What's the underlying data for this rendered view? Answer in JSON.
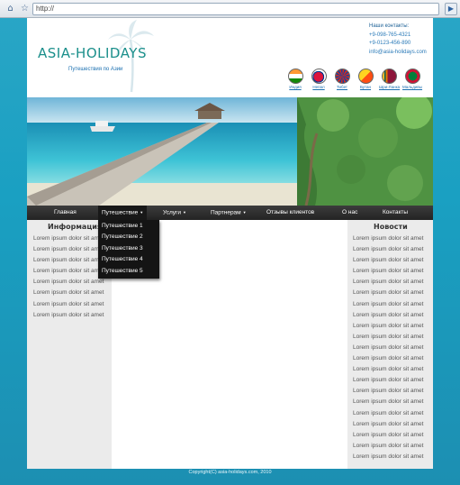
{
  "browser": {
    "home_icon": "home-icon",
    "star_icon": "star-icon",
    "url": "http://",
    "go_icon": "play-icon"
  },
  "header": {
    "logo": "ASIA-HOLIDAYS",
    "tagline": "Путешествия по Азии",
    "contacts": {
      "title": "Наши контакты:",
      "phone1": "+9-098-765-4321",
      "phone2": "+9-0123-456-890",
      "email": "info@asia-holidays.com"
    },
    "flags": [
      {
        "label": "Индия",
        "colors": [
          "#ff9933",
          "#ffffff",
          "#138808"
        ]
      },
      {
        "label": "Непал",
        "colors": [
          "#dc143c",
          "#ffffff",
          "#003893"
        ]
      },
      {
        "label": "Тибет",
        "colors": [
          "#d52b1e",
          "#ffd400",
          "#1e3f9a"
        ]
      },
      {
        "label": "Бутан",
        "colors": [
          "#ffd520",
          "#ff4e12",
          "#ffffff"
        ]
      },
      {
        "label": "Шри-Ланка",
        "colors": [
          "#8d153a",
          "#ffbe29",
          "#eb7400"
        ]
      },
      {
        "label": "Мальдивы",
        "colors": [
          "#d21034",
          "#007e3a",
          "#ffffff"
        ]
      }
    ]
  },
  "nav": {
    "items": [
      {
        "label": "Главная",
        "dropdown": false
      },
      {
        "label": "Путешествие",
        "dropdown": true
      },
      {
        "label": "Услуги",
        "dropdown": true
      },
      {
        "label": "Партнерам",
        "dropdown": true
      },
      {
        "label": "Отзывы клиентов",
        "dropdown": false
      },
      {
        "label": "О нас",
        "dropdown": false
      },
      {
        "label": "Контакты",
        "dropdown": false
      }
    ],
    "caret": "▼",
    "dropdown_items": [
      "Путешествие 1",
      "Путешествие 2",
      "Путешествие 3",
      "Путешествие 4",
      "Путешествие 5"
    ]
  },
  "left": {
    "title": "Информация",
    "items": [
      "Lorem ipsum dolor sit amet",
      "Lorem ipsum dolor sit amet",
      "Lorem ipsum dolor sit amet",
      "Lorem ipsum dolor sit amet",
      "Lorem ipsum dolor sit amet",
      "Lorem ipsum dolor sit amet",
      "Lorem ipsum dolor sit amet",
      "Lorem ipsum dolor sit amet"
    ]
  },
  "right": {
    "title": "Новости",
    "items": [
      "Lorem ipsum dolor sit amet",
      "Lorem ipsum dolor sit amet",
      "Lorem ipsum dolor sit amet",
      "Lorem ipsum dolor sit amet",
      "Lorem ipsum dolor sit amet",
      "Lorem ipsum dolor sit amet",
      "Lorem ipsum dolor sit amet",
      "Lorem ipsum dolor sit amet",
      "Lorem ipsum dolor sit amet",
      "Lorem ipsum dolor sit amet",
      "Lorem ipsum dolor sit amet",
      "Lorem ipsum dolor sit amet",
      "Lorem ipsum dolor sit amet",
      "Lorem ipsum dolor sit amet",
      "Lorem ipsum dolor sit amet",
      "Lorem ipsum dolor sit amet",
      "Lorem ipsum dolor sit amet",
      "Lorem ipsum dolor sit amet",
      "Lorem ipsum dolor sit amet",
      "Lorem ipsum dolor sit amet",
      "Lorem ipsum dolor sit amet"
    ]
  },
  "footer": "Copyright(C) asia-holidays.com, 2010"
}
